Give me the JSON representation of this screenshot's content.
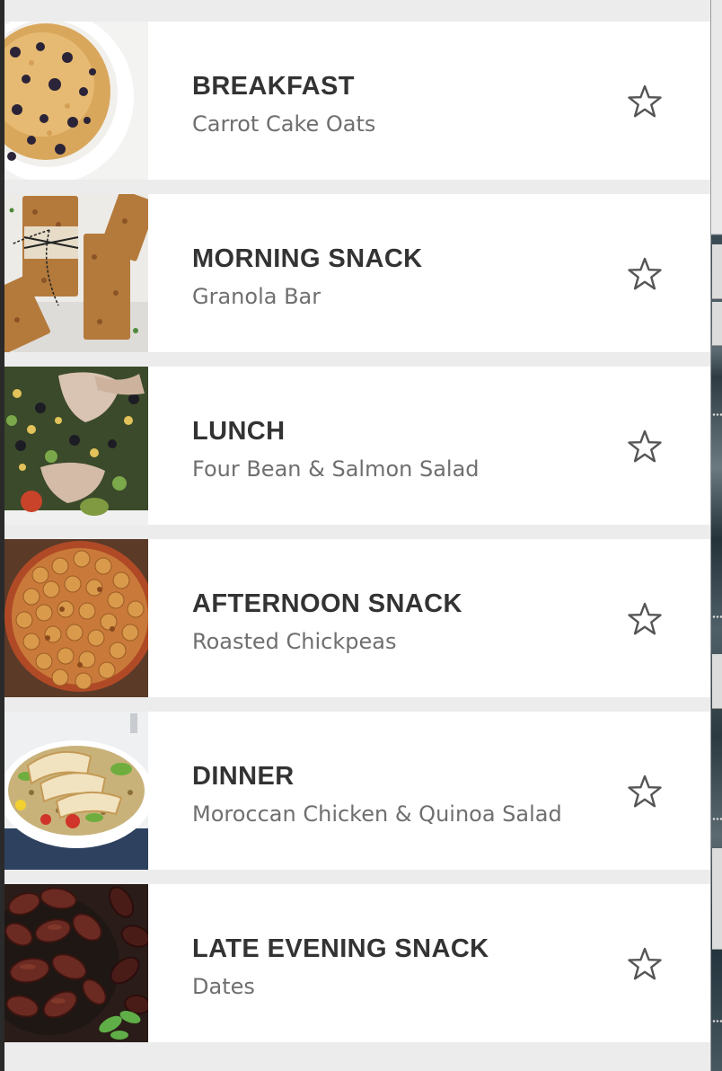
{
  "meals": [
    {
      "category": "BREAKFAST",
      "dish": "Carrot Cake Oats",
      "image_icon": "baked-oats-dish-icon"
    },
    {
      "category": "MORNING SNACK",
      "dish": "Granola Bar",
      "image_icon": "granola-bars-icon"
    },
    {
      "category": "LUNCH",
      "dish": "Four Bean & Salmon Salad",
      "image_icon": "salmon-salad-icon"
    },
    {
      "category": "AFTERNOON SNACK",
      "dish": "Roasted Chickpeas",
      "image_icon": "roasted-chickpeas-icon"
    },
    {
      "category": "DINNER",
      "dish": "Moroccan Chicken & Quinoa Salad",
      "image_icon": "chicken-quinoa-salad-icon"
    },
    {
      "category": "LATE EVENING SNACK",
      "dish": "Dates",
      "image_icon": "dates-bowl-icon"
    }
  ],
  "favorite_icon": "star-outline-icon",
  "colors": {
    "page_background": "#ececec",
    "card_background": "#ffffff",
    "title_text": "#333333",
    "dish_text": "#6f6f6f",
    "star_stroke": "#555555"
  }
}
